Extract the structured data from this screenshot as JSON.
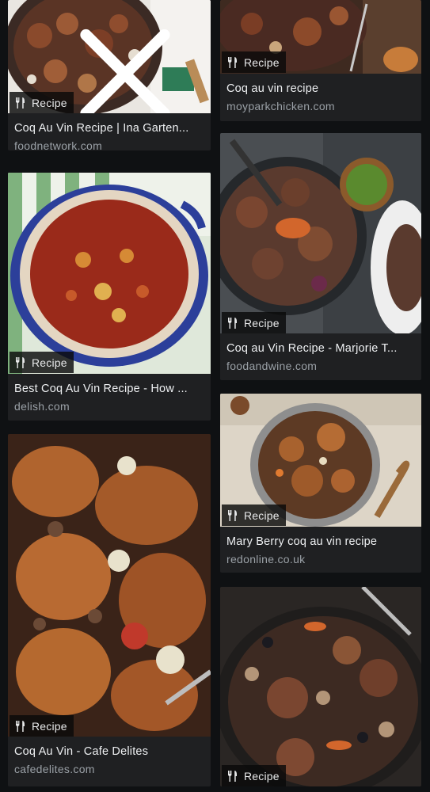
{
  "badge_label": "Recipe",
  "close_icon": "close-icon",
  "badge_icon": "fork-knife-icon",
  "results": {
    "left": [
      {
        "title": "Coq Au Vin Recipe | Ina Garten...",
        "domain": "foodnetwork.com"
      },
      {
        "title": "Best Coq Au Vin Recipe - How ...",
        "domain": "delish.com"
      },
      {
        "title": "Coq Au Vin - Cafe Delites",
        "domain": "cafedelites.com"
      }
    ],
    "right": [
      {
        "title": "Coq au vin recipe",
        "domain": "moyparkchicken.com"
      },
      {
        "title": "Coq au Vin Recipe - Marjorie T...",
        "domain": "foodandwine.com"
      },
      {
        "title": "Mary Berry coq au vin recipe",
        "domain": "redonline.co.uk"
      },
      {
        "title": "",
        "domain": ""
      }
    ]
  },
  "colors": {
    "page_bg": "#0f1113",
    "card_bg": "#1f2022",
    "domain_text": "#9aa0a6"
  }
}
